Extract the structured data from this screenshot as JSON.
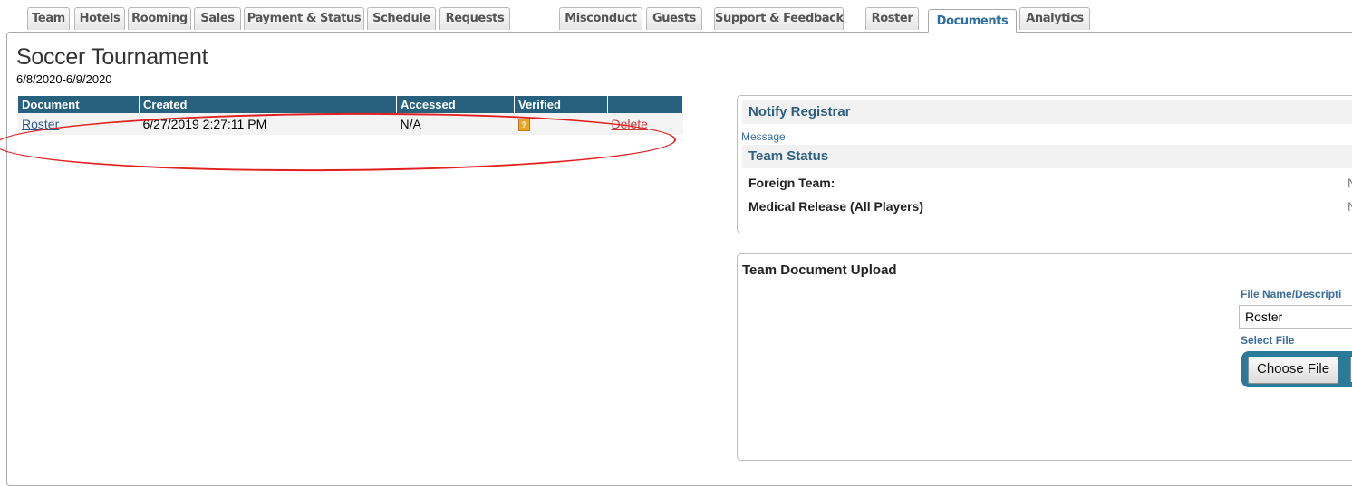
{
  "tabs": [
    {
      "label": "Team",
      "active": false
    },
    {
      "label": "Hotels",
      "active": false
    },
    {
      "label": "Rooming",
      "active": false
    },
    {
      "label": "Sales",
      "active": false
    },
    {
      "label": "Payment & Status",
      "active": false
    },
    {
      "label": "Schedule",
      "active": false
    },
    {
      "label": "Requests",
      "active": false
    },
    {
      "label": "Misconduct",
      "active": false
    },
    {
      "label": "Guests",
      "active": false
    },
    {
      "label": "Support & Feedback",
      "active": false
    },
    {
      "label": "Roster",
      "active": false
    },
    {
      "label": "Documents",
      "active": true
    },
    {
      "label": "Analytics",
      "active": false
    }
  ],
  "page": {
    "title": "Soccer Tournament",
    "date_range": "6/8/2020-6/9/2020"
  },
  "documents_table": {
    "headers": [
      "Document",
      "Created",
      "Accessed",
      "Verified",
      ""
    ],
    "rows": [
      {
        "document": "Roster",
        "created": "6/27/2019 2:27:11 PM",
        "accessed": "N/A",
        "verified_icon": "question-flag-icon",
        "action": "Delete"
      }
    ]
  },
  "notify": {
    "header": "Notify Registrar",
    "message_label": "Message"
  },
  "team_status": {
    "header": "Team Status",
    "items": [
      {
        "label": "Foreign Team:",
        "value": "N"
      },
      {
        "label": "Medical Release (All Players)",
        "value": "N"
      }
    ]
  },
  "upload": {
    "title": "Team Document Upload",
    "file_name_label": "File Name/Descripti",
    "file_name_value": "Roster",
    "select_file_label": "Select File",
    "choose_file_label": "Choose File"
  },
  "colors": {
    "table_header": "#27617d",
    "link": "#315a8c",
    "delete": "#c53a3a",
    "annotation": "#e11f1f",
    "active_tab_text": "#2c6fa0"
  }
}
